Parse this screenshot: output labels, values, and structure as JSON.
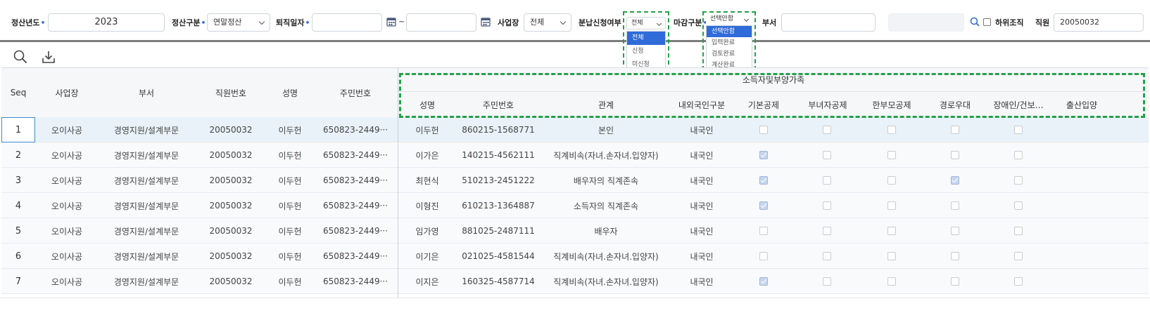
{
  "filters": {
    "year_label": "정산년도",
    "year_value": "2023",
    "type_label": "정산구분",
    "type_value": "연말정산",
    "retire_label": "퇴직일자",
    "retire_from": "",
    "retire_sep": "~",
    "retire_to": "",
    "site_label": "사업장",
    "site_value": "전체",
    "split_label": "분납신청여부",
    "split_value": "전체",
    "split_options": [
      "전체",
      "신청",
      "미신청"
    ],
    "close_label": "마감구분",
    "close_value": "선택안함",
    "close_options": [
      "선택안함",
      "입력완료",
      "검토완료",
      "계산완료"
    ],
    "dept_label": "부서",
    "dept_value": "",
    "sub_org_label": "하위조직",
    "emp_label": "직원",
    "emp_value": "20050032"
  },
  "grid": {
    "group_header": "소득자및부양가족",
    "headers": {
      "seq": "Seq",
      "site": "사업장",
      "dept": "부서",
      "emp_no": "직원번호",
      "name": "성명",
      "rrn": "주민번호",
      "f_name": "성명",
      "f_rrn": "주민번호",
      "relation": "관계",
      "nationality": "내외국인구분",
      "basic": "기본공제",
      "female": "부녀자공제",
      "single_parent": "한부모공제",
      "elderly": "경로우대",
      "disabled": "장애인/건보…",
      "birth": "출산입양"
    },
    "rows": [
      {
        "seq": "1",
        "site": "오이사공",
        "dept": "경영지원/설계부문",
        "emp_no": "20050032",
        "name": "이두헌",
        "rrn": "650823-2449···",
        "f_name": "이두헌",
        "f_rrn": "860215-1568771",
        "relation": "본인",
        "nationality": "내국인",
        "basic": false,
        "female": false,
        "single_parent": false,
        "elderly": false,
        "disabled": false
      },
      {
        "seq": "2",
        "site": "오이사공",
        "dept": "경영지원/설계부문",
        "emp_no": "20050032",
        "name": "이두헌",
        "rrn": "650823-2449···",
        "f_name": "이가은",
        "f_rrn": "140215-4562111",
        "relation": "직계비속(자녀.손자녀.입양자)",
        "nationality": "내국인",
        "basic": true,
        "female": false,
        "single_parent": false,
        "elderly": false,
        "disabled": false
      },
      {
        "seq": "3",
        "site": "오이사공",
        "dept": "경영지원/설계부문",
        "emp_no": "20050032",
        "name": "이두헌",
        "rrn": "650823-2449···",
        "f_name": "최현식",
        "f_rrn": "510213-2451222",
        "relation": "배우자의 직계존속",
        "nationality": "내국인",
        "basic": true,
        "female": false,
        "single_parent": false,
        "elderly": true,
        "disabled": false
      },
      {
        "seq": "4",
        "site": "오이사공",
        "dept": "경영지원/설계부문",
        "emp_no": "20050032",
        "name": "이두헌",
        "rrn": "650823-2449···",
        "f_name": "이형진",
        "f_rrn": "610213-1364887",
        "relation": "소득자의 직계존속",
        "nationality": "내국인",
        "basic": true,
        "female": false,
        "single_parent": false,
        "elderly": false,
        "disabled": false
      },
      {
        "seq": "5",
        "site": "오이사공",
        "dept": "경영지원/설계부문",
        "emp_no": "20050032",
        "name": "이두헌",
        "rrn": "650823-2449···",
        "f_name": "임가영",
        "f_rrn": "881025-2487111",
        "relation": "배우자",
        "nationality": "내국인",
        "basic": false,
        "female": false,
        "single_parent": false,
        "elderly": false,
        "disabled": false
      },
      {
        "seq": "6",
        "site": "오이사공",
        "dept": "경영지원/설계부문",
        "emp_no": "20050032",
        "name": "이두헌",
        "rrn": "650823-2449···",
        "f_name": "이기은",
        "f_rrn": "021025-4581544",
        "relation": "직계비속(자녀.손자녀.입양자)",
        "nationality": "내국인",
        "basic": false,
        "female": false,
        "single_parent": false,
        "elderly": false,
        "disabled": false
      },
      {
        "seq": "7",
        "site": "오이사공",
        "dept": "경영지원/설계부문",
        "emp_no": "20050032",
        "name": "이두헌",
        "rrn": "650823-2449···",
        "f_name": "이지은",
        "f_rrn": "160325-4587714",
        "relation": "직계비속(자녀.손자녀.입양자)",
        "nationality": "내국인",
        "basic": true,
        "female": false,
        "single_parent": false,
        "elderly": false,
        "disabled": false
      }
    ]
  },
  "colors": {
    "accent": "#2f6bd9",
    "highlight_dash": "#23a04a",
    "selected_row": "#e8f2f8"
  }
}
